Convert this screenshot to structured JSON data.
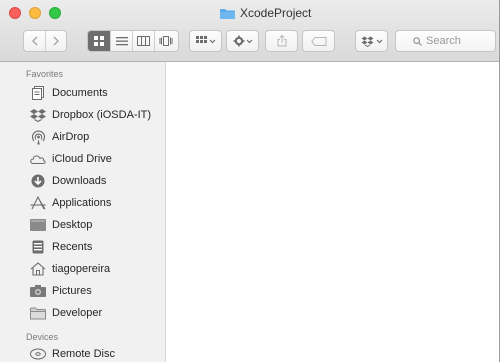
{
  "window": {
    "title": "XcodeProject"
  },
  "toolbar": {
    "search_placeholder": "Search",
    "icons": [
      "back-icon",
      "forward-icon",
      "icon-view-icon",
      "list-view-icon",
      "column-view-icon",
      "cover-flow-icon",
      "arrange-icon",
      "action-gear-icon",
      "share-icon",
      "tag-icon",
      "dropbox-icon",
      "search-icon"
    ]
  },
  "sidebar": {
    "favorites_title": "Favorites",
    "favorites": [
      {
        "label": "Documents",
        "icon": "documents-icon"
      },
      {
        "label": "Dropbox (iOSDA-IT)",
        "icon": "dropbox-icon"
      },
      {
        "label": "AirDrop",
        "icon": "airdrop-icon"
      },
      {
        "label": "iCloud Drive",
        "icon": "cloud-icon"
      },
      {
        "label": "Downloads",
        "icon": "download-icon"
      },
      {
        "label": "Applications",
        "icon": "applications-icon"
      },
      {
        "label": "Desktop",
        "icon": "desktop-icon"
      },
      {
        "label": "Recents",
        "icon": "recents-icon"
      },
      {
        "label": "tiagopereira",
        "icon": "home-icon"
      },
      {
        "label": "Pictures",
        "icon": "camera-icon"
      },
      {
        "label": "Developer",
        "icon": "folder-icon"
      }
    ],
    "devices_title": "Devices",
    "devices": [
      {
        "label": "Remote Disc",
        "icon": "disc-icon"
      }
    ]
  },
  "colors": {
    "close": "#fc605c",
    "minimize": "#fdbc40",
    "maximize": "#34c84a",
    "folder": "#5aa9e8",
    "sidebar_bg": "#f1f1f1",
    "icon_gray": "#6d6d6d"
  }
}
